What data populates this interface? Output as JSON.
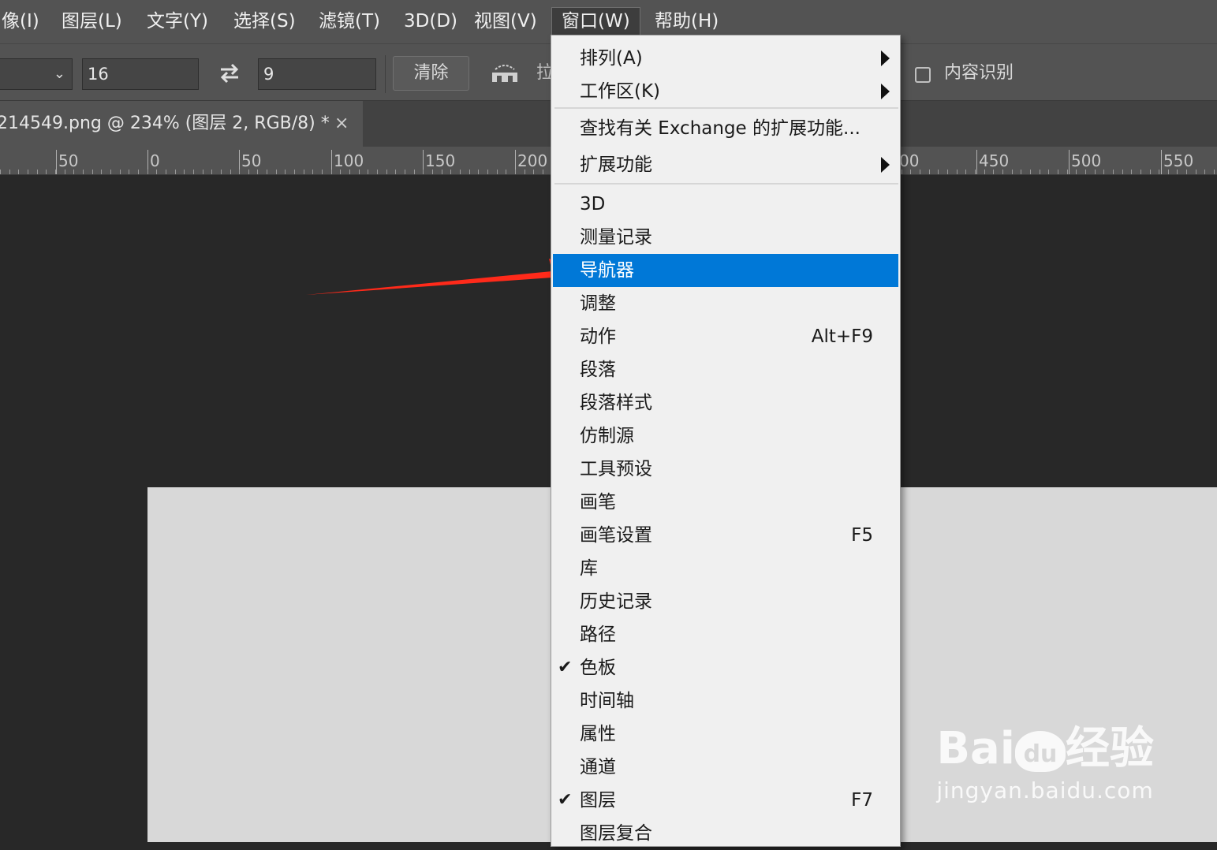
{
  "menubar": {
    "items": [
      "像(I)",
      "图层(L)",
      "文字(Y)",
      "选择(S)",
      "滤镜(T)",
      "3D(D)",
      "视图(V)",
      "窗口(W)",
      "帮助(H)"
    ]
  },
  "options": {
    "field1_value": "16",
    "field2_value": "9",
    "clear_label": "清除",
    "partial_label": "拉",
    "content_aware_label": "内容识别"
  },
  "doc_tab": {
    "title": "214549.png @ 234% (图层 2, RGB/8) *",
    "close": "×"
  },
  "ruler": {
    "labels": [
      "50",
      "0",
      "50",
      "100",
      "150",
      "200",
      "00",
      "450",
      "500",
      "550"
    ]
  },
  "window_menu": {
    "items": [
      {
        "label": "排列(A)",
        "submenu": true
      },
      {
        "label": "工作区(K)",
        "submenu": true
      },
      {
        "label": "查找有关 Exchange 的扩展功能..."
      },
      {
        "label": "扩展功能",
        "submenu": true
      },
      {
        "label": "3D"
      },
      {
        "label": "测量记录"
      },
      {
        "label": "导航器",
        "highlighted": true
      },
      {
        "label": "调整"
      },
      {
        "label": "动作",
        "shortcut": "Alt+F9"
      },
      {
        "label": "段落"
      },
      {
        "label": "段落样式"
      },
      {
        "label": "仿制源"
      },
      {
        "label": "工具预设"
      },
      {
        "label": "画笔"
      },
      {
        "label": "画笔设置",
        "shortcut": "F5"
      },
      {
        "label": "库"
      },
      {
        "label": "历史记录"
      },
      {
        "label": "路径"
      },
      {
        "label": "色板",
        "checked": true
      },
      {
        "label": "时间轴"
      },
      {
        "label": "属性"
      },
      {
        "label": "通道"
      },
      {
        "label": "图层",
        "checked": true,
        "shortcut": "F7"
      },
      {
        "label": "图层复合"
      }
    ]
  },
  "watermark": {
    "brand": "Bai",
    "paw": "du",
    "suffix": "经验",
    "url": "jingyan.baidu.com"
  },
  "colors": {
    "highlight": "#0078d7",
    "annotation_arrow": "#ff2a1a"
  }
}
